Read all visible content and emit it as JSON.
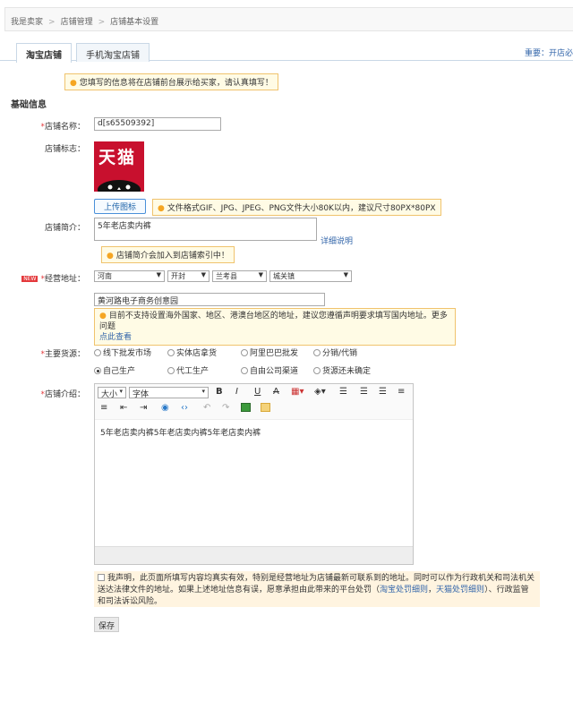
{
  "breadcrumb": [
    "我是卖家",
    "店铺管理",
    "店铺基本设置"
  ],
  "breadcrumb_sep": ">",
  "tabs": [
    {
      "label": "淘宝店铺"
    },
    {
      "label": "手机淘宝店铺"
    }
  ],
  "notice_link": "重要：开店必",
  "top_tip": "您填写的信息将在店铺前台展示给买家，请认真填写！",
  "section_title": "基础信息",
  "required_mark": "*",
  "shop_name": {
    "label": "店铺名称：",
    "value": "d[s65509392]"
  },
  "shop_logo": {
    "label": "店铺标志：",
    "logo_text": "天猫",
    "upload_button": "上传图标",
    "tip": "文件格式GIF、JPG、JPEG、PNG文件大小80K以内，建议尺寸80PX*80PX"
  },
  "shop_intro": {
    "label": "店铺简介：",
    "value": "5年老店卖内裤",
    "help_link": "详细说明",
    "tip": "店铺简介会加入到店铺索引中！"
  },
  "address": {
    "new_badge": "NEW",
    "label": "经营地址：",
    "selects": [
      "河南",
      "开封",
      "兰考县",
      "城关镇"
    ],
    "street": "黄河路电子商务创意园",
    "tip_text": "目前不支持设置海外国家、地区、港澳台地区的地址，建议您遵循声明要求填写国内地址。更多问题",
    "tip_link": "点此查看"
  },
  "source": {
    "label": "主要货源：",
    "row1": [
      "线下批发市场",
      "实体店拿货",
      "阿里巴巴批发",
      "分销/代销"
    ],
    "row2": [
      "自己生产",
      "代工生产",
      "自由公司渠道",
      "货源还未确定"
    ],
    "selected": "自己生产"
  },
  "intro": {
    "label": "店铺介绍：",
    "font_size": "大小",
    "font_family": "字体",
    "content": "5年老店卖内裤5年老店卖内裤5年老店卖内裤"
  },
  "declaration": {
    "text1": "我声明，此页面所填写内容均真实有效，特别是经营地址为店铺最新可联系到的地址。同时可以作为行政机关和司法机关送达法律文件的地址。如果上述地址信息有误，愿意承担由此带来的平台处罚（",
    "link1": "淘宝处罚细则",
    "comma": "，",
    "link2": "天猫处罚细则",
    "text2": "）、行政监管和司法诉讼风险。"
  },
  "save_button": "保存",
  "colors": {
    "accent": "#3366aa",
    "logo_bg": "#c8102e",
    "tip_bg": "#fffbe5",
    "declaration_bg": "#fff4e0"
  }
}
